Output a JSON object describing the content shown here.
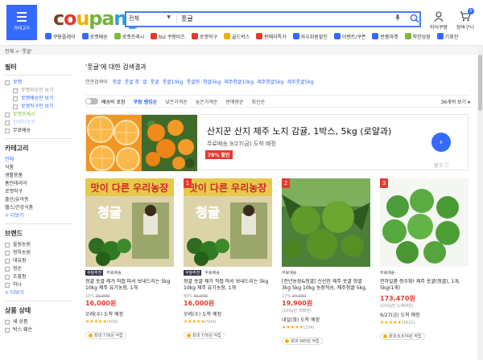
{
  "header": {
    "category_label": "카테고리",
    "search": {
      "scope": "전체",
      "query": "풋귤"
    },
    "my_label": "마이쿠팡",
    "cart_label": "장바구니",
    "cart_count": "0",
    "brand_colors": [
      "#7b3f26",
      "#e33b2e",
      "#f0b000",
      "#73b43a",
      "#29a1dc"
    ],
    "brand": {
      "c1": "c",
      "c2": "o",
      "c3": "u",
      "c4": "pa",
      "c5": "ng"
    }
  },
  "quicknav": [
    {
      "label": "쿠팡플레이",
      "color": "#346aff"
    },
    {
      "label": "로켓배송",
      "color": "#346aff"
    },
    {
      "label": "로켓프레시",
      "color": "#7cba3f"
    },
    {
      "label": "biz 쿠팡비즈",
      "color": "#e33b2e"
    },
    {
      "label": "로켓직구",
      "color": "#e33b2e"
    },
    {
      "label": "골드박스",
      "color": "#f0b000"
    },
    {
      "label": "판매자특가",
      "color": "#e33b2e"
    },
    {
      "label": "와우회원할인",
      "color": "#346aff"
    },
    {
      "label": "이벤트/쿠폰",
      "color": "#346aff"
    },
    {
      "label": "반품마켓",
      "color": "#346aff"
    },
    {
      "label": "착한상점",
      "color": "#7cba3f"
    },
    {
      "label": "기획전",
      "color": "#346aff"
    }
  ],
  "breadcrumb": [
    "전체",
    "'풋귤'"
  ],
  "sidebar": {
    "filter_title": "필터",
    "rocket_label": "로켓",
    "rocket_subs": [
      "로켓와우만 보기",
      "로켓배송만 보기",
      "로켓직구만 보기"
    ],
    "fresh_label": "로켓프레시",
    "fresh2_label": "판매자로켓",
    "free_label": "무료배송",
    "category_title": "카테고리",
    "categories": [
      "전체",
      "식품",
      "생활용품",
      "홈인테리어",
      "로켓직구",
      "출산/유아동",
      "헬스/건강식품"
    ],
    "more_label": "+ 더보기",
    "brand_title": "브랜드",
    "brands": [
      "올림농원",
      "청하농원",
      "대유팜",
      "정순",
      "조흥팜",
      "하나"
    ],
    "brand_more": "+ 더보기",
    "state_title": "상품 상태",
    "states": [
      "새 상품",
      "박스 훼손"
    ]
  },
  "main": {
    "result_title": "'풋귤'에 대한 검색결과",
    "related_label": "연관검색어",
    "related": [
      "청귤",
      "풋귤 청",
      "귤",
      "풋귤",
      "풋귤10kg",
      "풋귤청",
      "청귤5kg",
      "제주청귤10kg",
      "제주청귤5kg",
      "제주풋귤5kg"
    ],
    "sort": {
      "toggle_label": "배송비 포함",
      "options": [
        "쿠팡 랭킹순",
        "낮은가격순",
        "높은가격순",
        "판매량순",
        "최신순"
      ],
      "count_label": "36개씩 보기 ▾"
    },
    "ad": {
      "title": "산지꾼 산지 제주 노지 감귤, 1박스, 5kg (로얄과)",
      "delivery": "무료배송 9/27(금) 도착 예정",
      "discount": "79% 할인",
      "ad_label": "광고 ⓘ"
    },
    "products": [
      {
        "rank": "",
        "recommend": "쿠팡추천",
        "ship": "무료배송",
        "name": "청귤 풋귤 제가 직접 따서 보내드리는 5kg 10kg 제주 유기농장, 1개",
        "orig": "10%",
        "orig_price": "21,000",
        "price": "16,000원",
        "unit": "",
        "delivery": "모레(수) 도착 예정",
        "rating": "★★★★★",
        "reviews": "(509)",
        "points": "최대 776원 적립",
        "thumb": "poster"
      },
      {
        "rank": "1",
        "recommend": "쿠팡추천",
        "ship": "무료배송",
        "name": "청귤 풋귤 제가 직접 따서 보내드리는 5kg 10kg 제주 유기농장, 1개",
        "orig": "80%",
        "orig_price": "81,000",
        "price": "16,000원",
        "unit": "",
        "delivery": "모레(수) 도착 예정",
        "rating": "★★★★★",
        "reviews": "(509)",
        "points": "최대 776원 적립",
        "thumb": "poster"
      },
      {
        "rank": "2",
        "recommend": "",
        "ship": "무료배송",
        "name": "[천년농장&청귤] 신선한 제주 풋귤 청귤 3kg 5kg 10kg 농장직송, 제주청귤 5kg, 1개",
        "orig": "17%",
        "orig_price": "24,000",
        "price": "19,900원",
        "unit": "(100g당 398원)",
        "delivery": "내일(화) 도착 예정",
        "rating": "★★★★★",
        "reviews": "(234)",
        "points": "최대 995원 적립",
        "thumb": "tree"
      },
      {
        "rank": "3",
        "recommend": "",
        "ship": "무료배송",
        "name": "천하일품 청수확! 제주 풋귤(청귤), 1개, 5kg(1개)",
        "orig": "",
        "orig_price": "",
        "price": "173,470원",
        "unit": "(100g당 3,469원)",
        "delivery": "9/27(금) 도착 예정",
        "rating": "★★★★★",
        "reviews": "(1621)",
        "points": "최대 8,674원 적립",
        "thumb": "pile"
      }
    ]
  }
}
